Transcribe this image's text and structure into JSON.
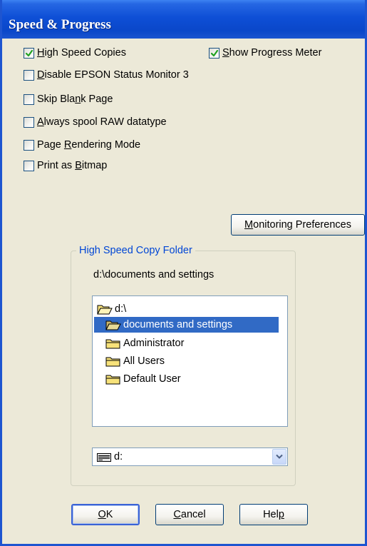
{
  "window": {
    "title": "Speed & Progress"
  },
  "options": {
    "high_speed_copies": {
      "pre": "",
      "key": "H",
      "post": "igh Speed Copies",
      "checked": true
    },
    "show_progress_meter": {
      "pre": "",
      "key": "S",
      "post": "how Progress Meter",
      "checked": true
    },
    "disable_status_monitor": {
      "pre": "",
      "key": "D",
      "post": "isable EPSON Status Monitor 3",
      "checked": false
    },
    "skip_blank_page": {
      "pre": "Skip Bla",
      "key": "n",
      "post": "k Page",
      "checked": false
    },
    "always_spool_raw": {
      "pre": "",
      "key": "A",
      "post": "lways spool RAW datatype",
      "checked": false
    },
    "page_rendering_mode": {
      "pre": "Page ",
      "key": "R",
      "post": "endering Mode",
      "checked": false
    },
    "print_as_bitmap": {
      "pre": "Print as ",
      "key": "B",
      "post": "itmap",
      "checked": false
    }
  },
  "monitoring_button": {
    "key": "M",
    "post": "onitoring Preferences"
  },
  "folder_group": {
    "title": "High Speed Copy Folder",
    "current_path": "d:\\documents and settings",
    "items": [
      {
        "label": "d:\\",
        "icon": "open-folder-icon",
        "selected": false
      },
      {
        "label": "documents and settings",
        "icon": "open-folder-icon",
        "selected": true
      },
      {
        "label": "Administrator",
        "icon": "folder-icon",
        "selected": false
      },
      {
        "label": "All Users",
        "icon": "folder-icon",
        "selected": false
      },
      {
        "label": "Default User",
        "icon": "folder-icon",
        "selected": false
      }
    ],
    "drive": {
      "value": "d:",
      "icon": "drive-icon"
    }
  },
  "buttons": {
    "ok": {
      "key": "O",
      "post": "K"
    },
    "cancel": {
      "key": "C",
      "post": "ancel"
    },
    "help": {
      "pre": "Hel",
      "key": "p",
      "post": ""
    }
  },
  "colors": {
    "title_bar": "#0a47c9",
    "selection": "#316ac5",
    "dialog_bg": "#ece9d8",
    "group_title": "#0046d5",
    "checkmark": "#21a121"
  }
}
